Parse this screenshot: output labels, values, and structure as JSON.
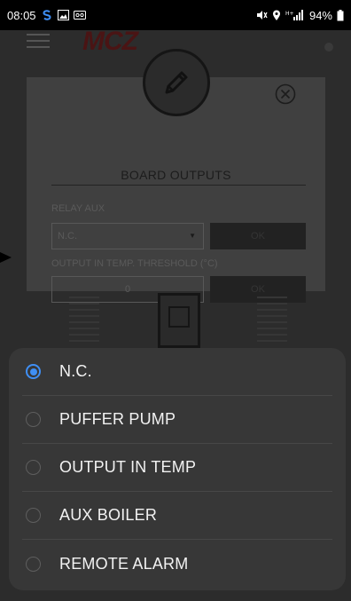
{
  "status_bar": {
    "time": "08:05",
    "battery": "94%",
    "left_icons": [
      "samsung-s-icon",
      "gallery-icon",
      "voicemail-icon"
    ],
    "right_icons": [
      "mute-icon",
      "location-icon",
      "signal-icon",
      "battery-icon"
    ]
  },
  "app": {
    "brand": "MCZ"
  },
  "dialog": {
    "title": "BOARD OUTPUTS",
    "relay_label": "RELAY AUX",
    "relay_value": "N.C.",
    "relay_ok": "OK",
    "threshold_label": "OUTPUT IN TEMP. THRESHOLD (°C)",
    "threshold_value": "0",
    "threshold_ok": "OK"
  },
  "sheet": {
    "options": [
      {
        "label": "N.C.",
        "selected": true
      },
      {
        "label": "PUFFER PUMP",
        "selected": false
      },
      {
        "label": "OUTPUT IN TEMP",
        "selected": false
      },
      {
        "label": "AUX BOILER",
        "selected": false
      },
      {
        "label": "REMOTE ALARM",
        "selected": false
      }
    ]
  },
  "colors": {
    "accent": "#3f8ff5",
    "overlay_bg": "#2c2c2c",
    "sheet_bg": "#373737",
    "brand": "#4a1414"
  }
}
